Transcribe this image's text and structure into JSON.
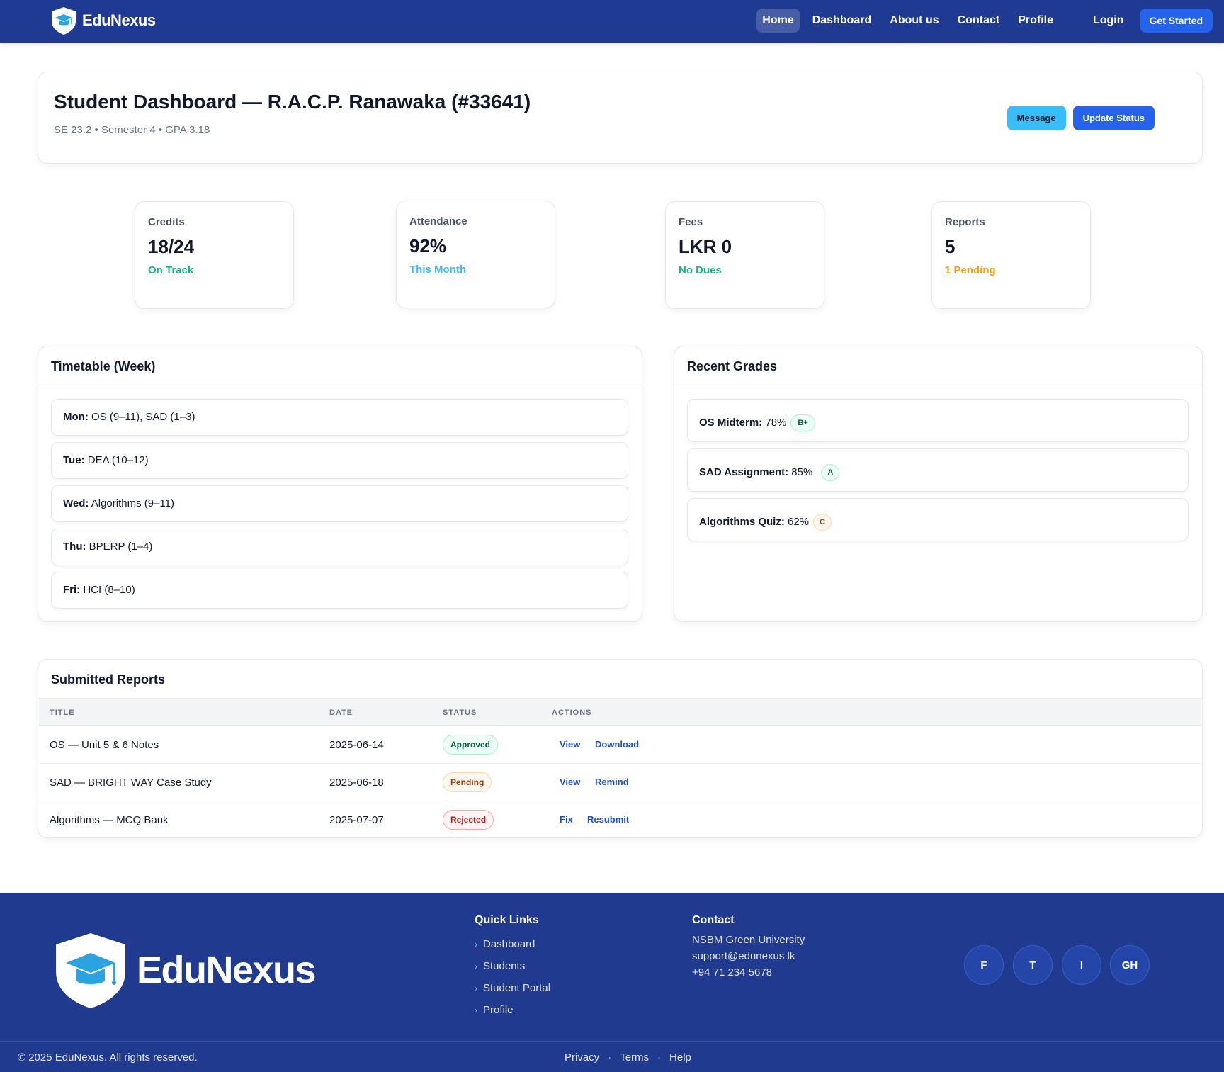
{
  "nav": {
    "brand": "EduNexus",
    "links": [
      "Home",
      "Dashboard",
      "About us",
      "Contact",
      "Profile",
      "Login"
    ],
    "cta": "Get Started"
  },
  "header": {
    "title": "Student Dashboard — R.A.C.P. Ranawaka (#33641)",
    "subtitle": "SE 23.2 • Semester 4 • GPA 3.18",
    "message_label": "Message",
    "update_label": "Update Status"
  },
  "stats": [
    {
      "label": "Credits",
      "value": "18/24",
      "note": "On Track",
      "note_color": "#10b981"
    },
    {
      "label": "Attendance",
      "value": "92%",
      "note": "This Month",
      "note_color": "#38bdf8"
    },
    {
      "label": "Fees",
      "value": "LKR 0",
      "note": "No Dues",
      "note_color": "#10b981"
    },
    {
      "label": "Reports",
      "value": "5",
      "note": "1 Pending",
      "note_color": "#f59e0b"
    }
  ],
  "timetable": {
    "title": "Timetable (Week)",
    "items": [
      {
        "day": "Mon:",
        "text": "OS (9–11), SAD (1–3)"
      },
      {
        "day": "Tue:",
        "text": "DEA (10–12)"
      },
      {
        "day": "Wed:",
        "text": "Algorithms (9–11)"
      },
      {
        "day": "Thu:",
        "text": "BPERP (1–4)"
      },
      {
        "day": "Fri:",
        "text": "HCI (8–10)"
      }
    ]
  },
  "grades": {
    "title": "Recent Grades",
    "items": [
      {
        "name": "OS Midterm:",
        "score": "78%",
        "grade": "B+"
      },
      {
        "name": "SAD Assignment:",
        "score": "85%",
        "grade": "A"
      },
      {
        "name": "Algorithms Quiz:",
        "score": "62%",
        "grade": "C"
      }
    ]
  },
  "reports": {
    "title": "Submitted Reports",
    "columns": [
      "TITLE",
      "DATE",
      "STATUS",
      "ACTIONS"
    ],
    "rows": [
      {
        "title": "OS — Unit 5 & 6 Notes",
        "date": "2025-06-14",
        "status": "Approved",
        "actions": [
          "View",
          "Download"
        ]
      },
      {
        "title": "SAD — BRIGHT WAY Case Study",
        "date": "2025-06-18",
        "status": "Pending",
        "actions": [
          "View",
          "Remind"
        ]
      },
      {
        "title": "Algorithms — MCQ Bank",
        "date": "2025-07-07",
        "status": "Rejected",
        "actions": [
          "Fix",
          "Resubmit"
        ]
      }
    ]
  },
  "footer": {
    "brand": "EduNexus",
    "quick_links_title": "Quick Links",
    "quick_links": [
      "Dashboard",
      "Students",
      "Student Portal",
      "Profile"
    ],
    "contact_title": "Contact",
    "contact": [
      "NSBM Green University",
      "support@edunexus.lk",
      "+94 71 234 5678"
    ],
    "social": [
      "F",
      "T",
      "I",
      "GH"
    ],
    "copyright": "© 2025 EduNexus. All rights reserved.",
    "legal": [
      "Privacy",
      "Terms",
      "Help"
    ]
  },
  "colors": {
    "nav_bg": "#1f3a93",
    "primary": "#2563eb",
    "accent": "#38bdf8",
    "success": "#10b981",
    "warning": "#f59e0b"
  },
  "icons": {
    "brand_logo": "graduation-cap-shield-icon",
    "list_bullet": "chevron-right-icon"
  }
}
